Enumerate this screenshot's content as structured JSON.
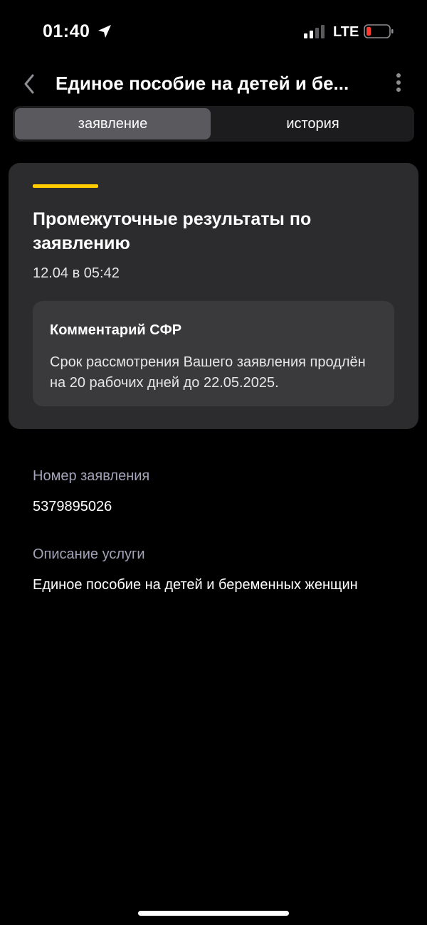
{
  "status_bar": {
    "time": "01:40",
    "network": "LTE",
    "icons": {
      "location": "location-arrow-icon",
      "signal": "signal-bars-icon",
      "battery": "battery-low-icon"
    },
    "battery_color": "#ff3b30"
  },
  "header": {
    "title": "Единое пособие на детей и бе...",
    "icons": {
      "back": "chevron-left-icon",
      "more": "more-vertical-icon"
    }
  },
  "tabs": [
    {
      "label": "заявление",
      "active": true
    },
    {
      "label": "история",
      "active": false
    }
  ],
  "card": {
    "accent_color": "#ffcc00",
    "title": "Промежуточные результаты по заявлению",
    "date": "12.04 в 05:42",
    "comment": {
      "title": "Комментарий СФР",
      "text": "Срок рассмотрения Вашего заявления продлён на 20 рабочих дней до 22.05.2025."
    }
  },
  "info": {
    "number_label": "Номер заявления",
    "number_value": "5379895026",
    "service_label": "Описание услуги",
    "service_value": "Единое пособие на детей и беременных женщин"
  }
}
